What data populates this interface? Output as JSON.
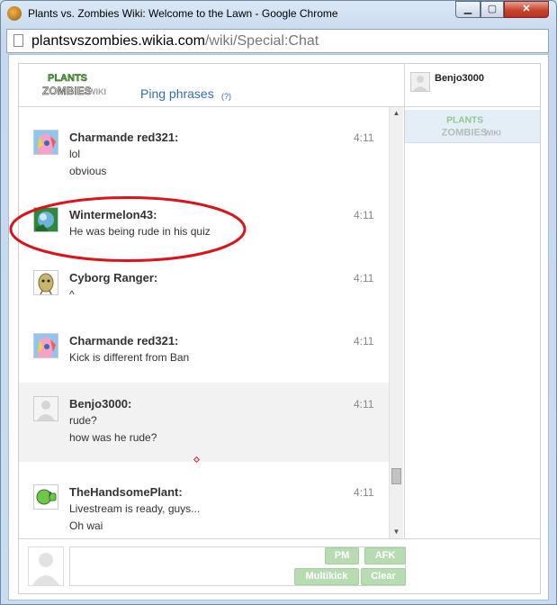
{
  "window": {
    "title": "Plants vs. Zombies Wiki: Welcome to the Lawn - Google Chrome"
  },
  "address": {
    "domain": "plantsvszombies.wikia.com",
    "path": "/wiki/Special:Chat"
  },
  "header": {
    "logo": {
      "line1": "PLANTS",
      "line2": "ZOMBIES",
      "line3": "WIKI"
    },
    "ping_label": "Ping phrases",
    "ping_help": "(?)",
    "current_user": "Benjo3000"
  },
  "messages": [
    {
      "user": "Charmande red321:",
      "time": "4:11",
      "lines": [
        "lol",
        "obvious"
      ],
      "avatar": "pony-avatar"
    },
    {
      "user": "Wintermelon43:",
      "time": "4:11",
      "lines": [
        "He was being rude in his quiz"
      ],
      "avatar": "wintermelon-avatar"
    },
    {
      "user": "Cyborg Ranger:",
      "time": "4:11",
      "lines": [
        "^"
      ],
      "avatar": "potato-avatar"
    },
    {
      "user": "Charmande red321:",
      "time": "4:11",
      "lines": [
        "Kick is different from Ban"
      ],
      "avatar": "pony-avatar"
    },
    {
      "user": "Benjo3000:",
      "time": "4:11",
      "lines": [
        "rude?",
        "how was he rude?"
      ],
      "avatar": "default-avatar"
    },
    {
      "user": "TheHandsomePlant:",
      "time": "4:11",
      "lines": [
        "Livestream is ready, guys...",
        "Oh wai"
      ],
      "avatar": "peashooter-avatar"
    }
  ],
  "controls": {
    "pm": "PM",
    "afk": "AFK",
    "multikick": "Multikick",
    "clear": "Clear"
  },
  "colors": {
    "link": "#2f6db5",
    "button": "#b7dcb2",
    "annotation": "#d9141b",
    "self_row": "#f2f2f2"
  }
}
